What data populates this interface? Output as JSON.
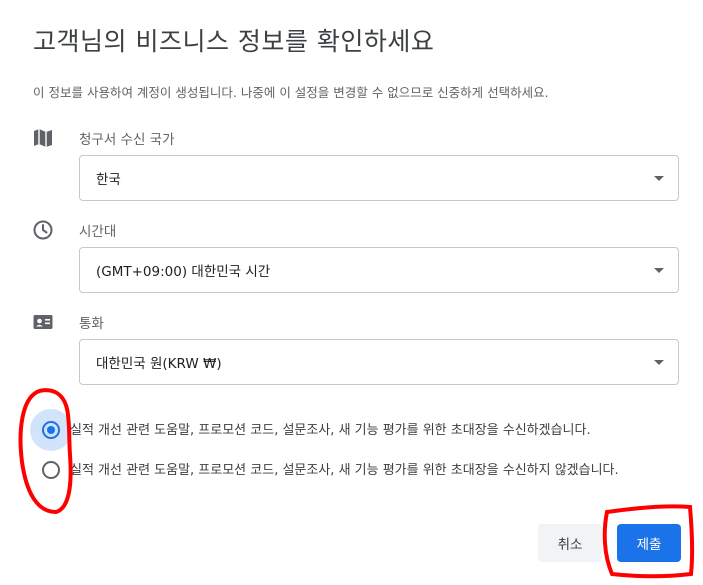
{
  "dialog": {
    "title": "고객님의 비즈니스 정보를 확인하세요",
    "subtitle": "이 정보를 사용하여 계정이 생성됩니다. 나중에 이 설정을 변경할 수 없으므로 신중하게 선택하세요."
  },
  "country": {
    "label": "청구서 수신 국가",
    "value": "한국",
    "icon": "map-icon"
  },
  "timezone": {
    "label": "시간대",
    "value": "(GMT+09:00) 대한민국 시간",
    "icon": "clock-icon"
  },
  "currency": {
    "label": "통화",
    "value": "대한민국 원(KRW ₩)",
    "icon": "currency-card-icon"
  },
  "radios": [
    {
      "label": "실적 개선 관련 도움말, 프로모션 코드, 설문조사, 새 기능 평가를 위한 초대장을 수신하겠습니다.",
      "selected": true
    },
    {
      "label": "실적 개선 관련 도움말, 프로모션 코드, 설문조사, 새 기능 평가를 위한 초대장을 수신하지 않겠습니다.",
      "selected": false
    }
  ],
  "buttons": {
    "cancel": "취소",
    "submit": "제출"
  },
  "colors": {
    "accent": "#1a73e8",
    "annotation": "#ff0000"
  }
}
